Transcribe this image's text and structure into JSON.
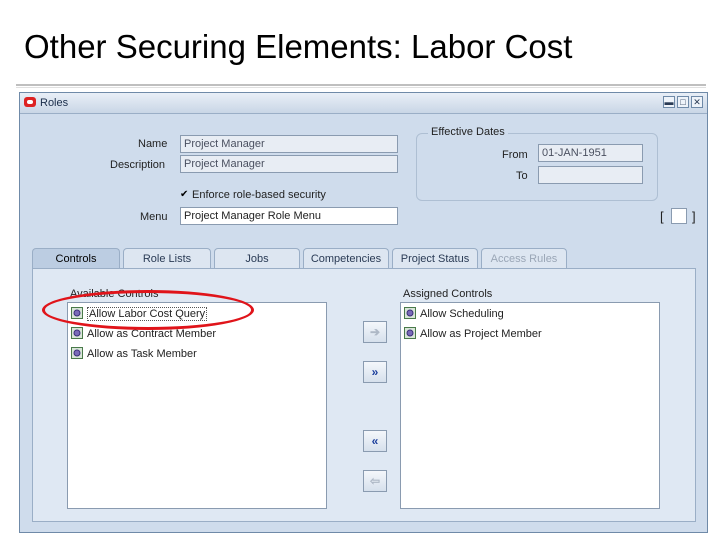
{
  "slide": {
    "title": "Other Securing Elements: Labor Cost"
  },
  "window": {
    "title": "Roles",
    "buttons": {
      "minimize": "▬",
      "maximize": "□",
      "close": "✕"
    }
  },
  "form": {
    "name_label": "Name",
    "name_value": "Project Manager",
    "description_label": "Description",
    "description_value": "Project Manager",
    "enforce_label": "Enforce role-based security",
    "enforce_check": "✔",
    "menu_label": "Menu",
    "menu_value": "Project Manager Role Menu",
    "effective_dates_label": "Effective Dates",
    "from_label": "From",
    "from_value": "01-JAN-1951",
    "to_label": "To",
    "to_value": "",
    "bracket_open": "[",
    "bracket_close": "]"
  },
  "tabs": [
    {
      "label": "Controls"
    },
    {
      "label": "Role Lists"
    },
    {
      "label": "Jobs"
    },
    {
      "label": "Competencies"
    },
    {
      "label": "Project Status"
    },
    {
      "label": "Access Rules"
    }
  ],
  "controls": {
    "available_title": "Available Controls",
    "assigned_title": "Assigned Controls",
    "available": [
      {
        "label": "Allow Labor Cost Query"
      },
      {
        "label": "Allow as Contract Member"
      },
      {
        "label": "Allow as Task Member"
      }
    ],
    "assigned": [
      {
        "label": "Allow Scheduling"
      },
      {
        "label": "Allow as Project Member"
      }
    ],
    "buttons": {
      "move_one": "➔",
      "move_all": "»",
      "remove_all": "«",
      "remove_one": "⇦"
    }
  },
  "colors": {
    "highlight": "#e0141a",
    "accent": "#1c3f9c"
  }
}
